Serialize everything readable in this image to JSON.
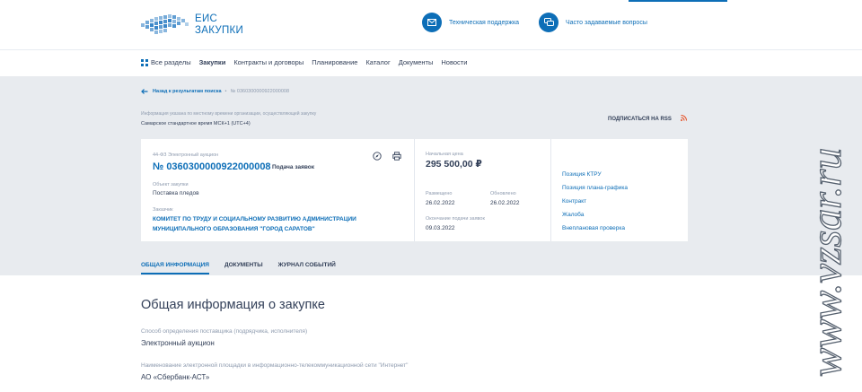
{
  "header": {
    "logo_line1": "ЕИС",
    "logo_line2": "ЗАКУПКИ",
    "support_label": "Техническая поддержка",
    "faq_label": "Часто задаваемые вопросы"
  },
  "nav": {
    "items": [
      {
        "label": "Все разделы"
      },
      {
        "label": "Закупки"
      },
      {
        "label": "Контракты и договоры"
      },
      {
        "label": "Планирование"
      },
      {
        "label": "Каталог"
      },
      {
        "label": "Документы"
      },
      {
        "label": "Новости"
      }
    ],
    "active_index": 1
  },
  "breadcrumb": {
    "back_label": "Назад к результатам поиска",
    "current": "№ 0360300000922000008"
  },
  "timezone": {
    "info": "Информация указана по местному времени организации, осуществляющей закупку",
    "value": "Самарское стандартное время МСК+1 (UTC+4)"
  },
  "rss": {
    "label": "ПОДПИСАТЬСЯ НА RSS"
  },
  "procurement": {
    "law_type": "44-ФЗ Электронный аукцион",
    "number": "№ 0360300000922000008",
    "stage": "Подача заявок",
    "object_label": "Объект закупки",
    "object_value": "Поставка пледов",
    "customer_label": "Заказчик",
    "customer_value": "КОМИТЕТ ПО ТРУДУ И СОЦИАЛЬНОМУ РАЗВИТИЮ АДМИНИСТРАЦИИ МУНИЦИПАЛЬНОГО ОБРАЗОВАНИЯ \"ГОРОД САРАТОВ\"",
    "price_label": "Начальная цена",
    "price_value": "295 500,00 ₽",
    "posted_label": "Размещено",
    "posted_value": "26.02.2022",
    "updated_label": "Обновлено",
    "updated_value": "26.02.2022",
    "deadline_label": "Окончание подачи заявок",
    "deadline_value": "09.03.2022"
  },
  "side_links": [
    {
      "label": "Позиция КТРУ"
    },
    {
      "label": "Позиция плана-графика"
    },
    {
      "label": "Контракт"
    },
    {
      "label": "Жалоба"
    },
    {
      "label": "Внеплановая проверка"
    }
  ],
  "tabs": [
    {
      "label": "ОБЩАЯ ИНФОРМАЦИЯ"
    },
    {
      "label": "ДОКУМЕНТЫ"
    },
    {
      "label": "ЖУРНАЛ СОБЫТИЙ"
    }
  ],
  "general": {
    "title": "Общая информация о закупке",
    "method_label": "Способ определения поставщика (подрядчика, исполнителя)",
    "method_value": "Электронный аукцион",
    "platform_label": "Наименование электронной площадки в информационно-телекоммуникационной сети \"Интернет\"",
    "platform_value": "АО «Сбербанк-АСТ»"
  },
  "watermark": {
    "text": "www.vzsar.ru"
  },
  "colors": {
    "accent": "#0d6eb7",
    "gray_bg": "#e8ebef",
    "rss": "#e64b1f"
  }
}
